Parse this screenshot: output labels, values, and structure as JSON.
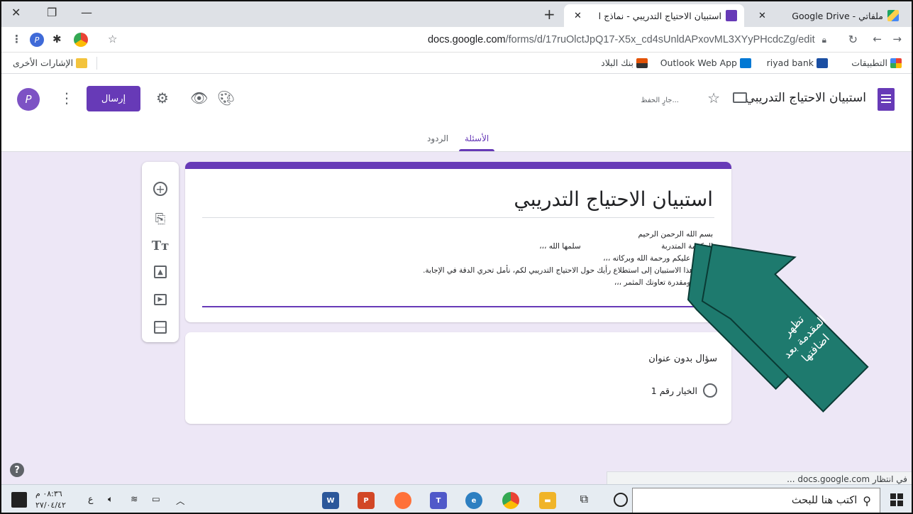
{
  "browser": {
    "tabs": [
      {
        "title": "ملفاتي - Google Drive",
        "active": false,
        "favicon_color": "#1fa463"
      },
      {
        "title": "استبيان الاحتياج التدريبي - نماذج ‎Google",
        "title_display": "استبيان الاحتياج التدريبي - نماذج ‎ا",
        "active": true,
        "favicon_color": "#673ab7"
      }
    ],
    "new_tab": "+",
    "url_host": "docs.google.com",
    "url_path": "/forms/d/17ruOlctJpQ17-X5x_cd4sUnldAPxovML3XYyPHcdcZg/edit",
    "bookmarks": [
      {
        "label": "التطبيقات",
        "color": "#ea4335"
      },
      {
        "label": "riyad bank",
        "color": "#1b4fa3"
      },
      {
        "label": "Outlook Web App",
        "color": "#0078d4"
      },
      {
        "label": "بنك البلاد",
        "color": "#e35205"
      }
    ],
    "other_bookmarks": "الإشارات الأخرى"
  },
  "forms": {
    "title": "استبيان الاحتياج التدريبي",
    "saving": "جارٍ الحفظ...",
    "send": "إرسال",
    "avatar_letter": "P",
    "tabs": {
      "questions": "الأسئلة",
      "responses": "الردود"
    },
    "form_title": "استبيان الاحتياج التدريبي",
    "description": [
      "بسم الله الرحمن الرحيم",
      "المكرمة المتدربة                                  سلمها الله ،،،",
      "السلام عليكم ورحمة الله وبركاته ،،،",
      "يهدف هذا الاستبيان إلى استطلاع رأيك حول الاحتياج التدريبي لكم، نأمل تحري الدقة في الإجابة.",
      "شاكرة ومقدرة تعاونك المثمر ،،،"
    ],
    "question": {
      "title": "سؤال بدون عنوان",
      "option": "الخيار رقم 1"
    },
    "arrow_text": "تظهر المقدمة بعد اضافتها",
    "accent_color": "#673ab7",
    "arrow_color": "#1e7a6e"
  },
  "status_bar": "في انتظار docs.google.com ...",
  "taskbar": {
    "search_placeholder": "اكتب هنا للبحث",
    "time": "٠٨:٣٦ م",
    "date": "٢٧/٠٤/٤٢",
    "lang": "ع"
  }
}
